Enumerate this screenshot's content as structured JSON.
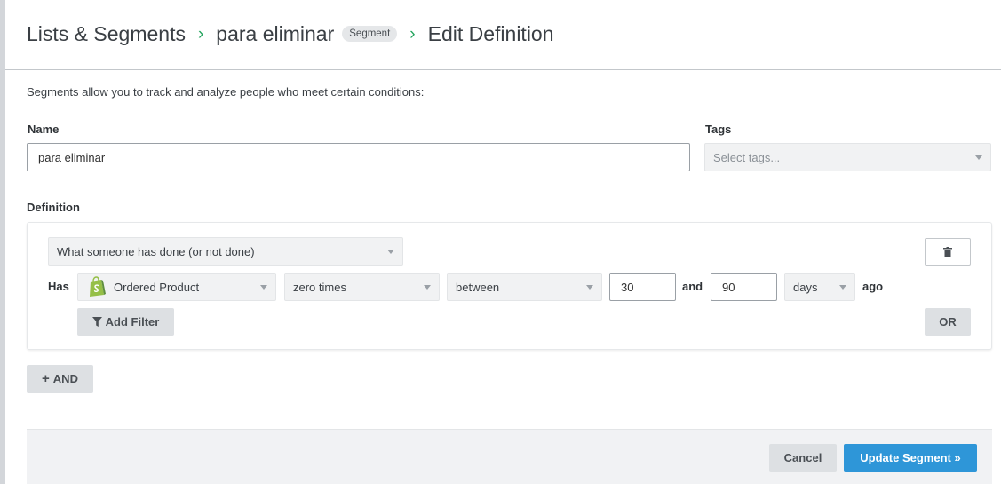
{
  "header": {
    "crumb1": "Lists & Segments",
    "crumb2": "para eliminar",
    "badge": "Segment",
    "crumb3": "Edit Definition"
  },
  "intro": "Segments allow you to track and analyze people who meet certain conditions:",
  "name": {
    "label": "Name",
    "value": "para eliminar"
  },
  "tags": {
    "label": "Tags",
    "placeholder": "Select tags..."
  },
  "definition": {
    "label": "Definition",
    "condition_type": "What someone has done (or not done)",
    "has_label": "Has",
    "metric": "Ordered Product",
    "frequency": "zero times",
    "range_type": "between",
    "from_value": "30",
    "and_label": "and",
    "to_value": "90",
    "unit": "days",
    "ago_label": "ago",
    "add_filter_label": "Add Filter",
    "or_label": "OR",
    "and_button_label": "AND"
  },
  "footer": {
    "cancel_label": "Cancel",
    "update_label": "Update Segment »"
  },
  "colors": {
    "accent_green": "#25a55f",
    "primary_blue": "#2e96d8",
    "shopify_green": "#95bf47"
  },
  "icons": {
    "metric": "shopify-bag-icon",
    "filter": "funnel-icon",
    "delete": "trash-icon",
    "chevron": "chevron-right-icon",
    "plus": "plus-icon"
  }
}
